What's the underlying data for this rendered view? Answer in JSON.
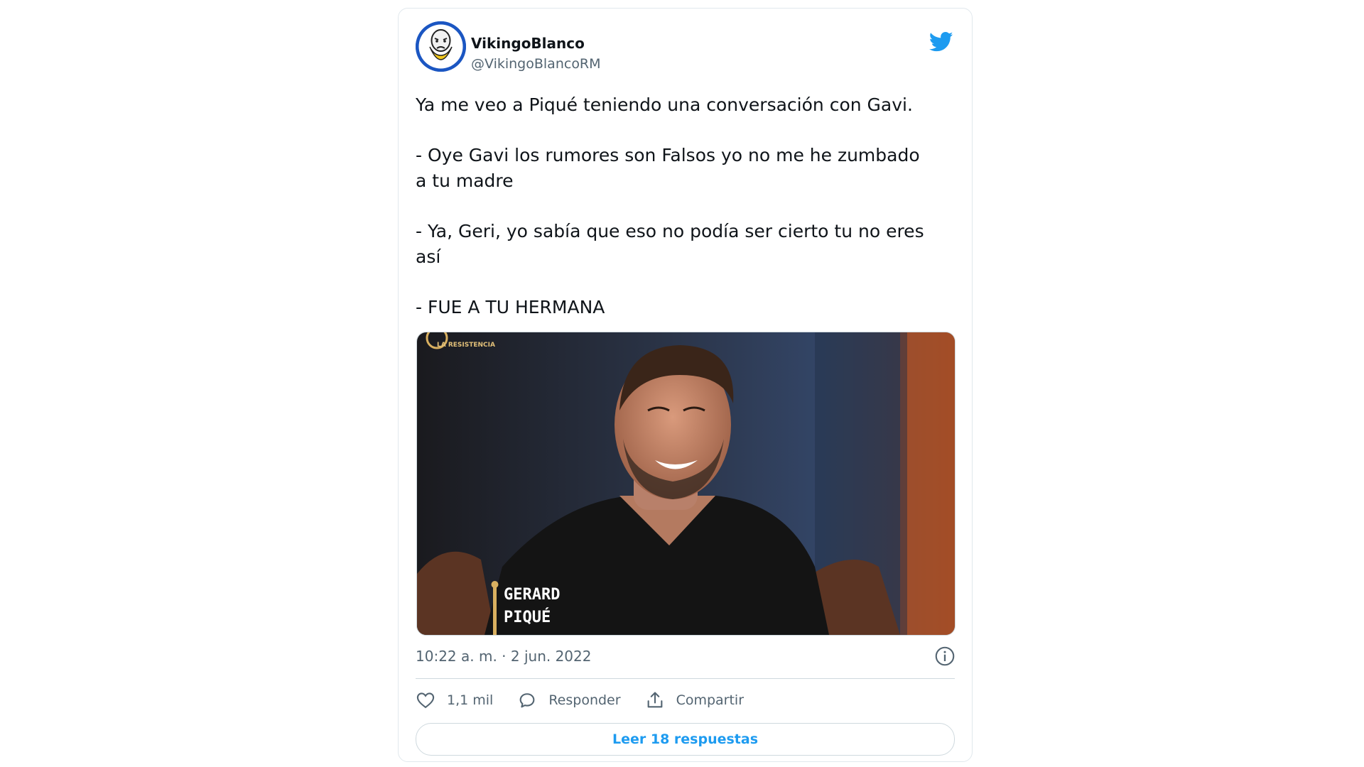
{
  "user": {
    "display_name": "VikingoBlanco",
    "handle": "@VikingoBlancoRM"
  },
  "icons": {
    "brand": "twitter-bird-icon",
    "info": "info-icon",
    "like": "heart-icon",
    "reply": "speech-bubble-icon",
    "share": "share-icon"
  },
  "colors": {
    "brand": "#1d9bf0",
    "text": "#0f1419",
    "secondary_text": "#536471",
    "border": "#cfd9de"
  },
  "tweet": {
    "paragraphs": [
      "Ya me veo a Piqué teniendo una conversación con Gavi.",
      "- Oye Gavi los rumores son Falsos yo no me he zumbado\na tu madre",
      "- Ya, Geri, yo sabía que eso no podía ser cierto tu no eres\nasí",
      "- FUE A TU HERMANA"
    ],
    "media": {
      "overlay_channel": "LA RESISTENCIA",
      "overlay_name_line1": "GERARD",
      "overlay_name_line2": "PIQUÉ"
    },
    "timestamp": "10:22 a. m. · 2 jun. 2022"
  },
  "actions": {
    "likes": "1,1 mil",
    "reply_label": "Responder",
    "share_label": "Compartir"
  },
  "read_replies_label": "Leer 18 respuestas"
}
